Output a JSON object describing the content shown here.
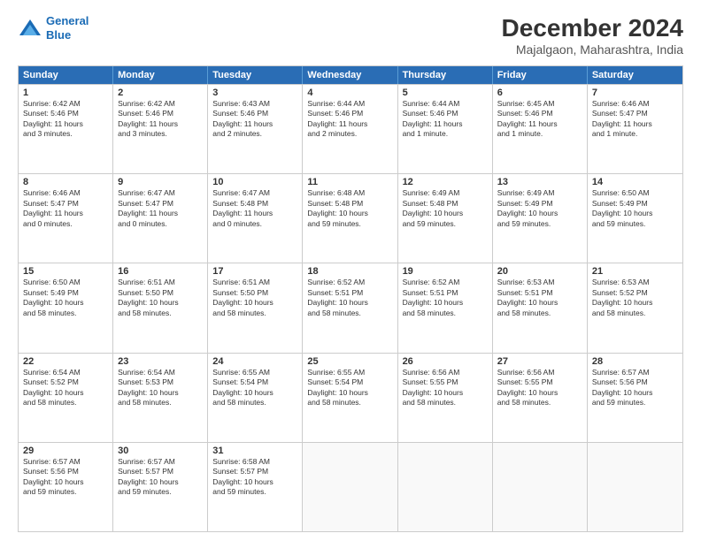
{
  "logo": {
    "line1": "General",
    "line2": "Blue"
  },
  "title": "December 2024",
  "subtitle": "Majalgaon, Maharashtra, India",
  "header_days": [
    "Sunday",
    "Monday",
    "Tuesday",
    "Wednesday",
    "Thursday",
    "Friday",
    "Saturday"
  ],
  "rows": [
    [
      {
        "day": "1",
        "text": "Sunrise: 6:42 AM\nSunset: 5:46 PM\nDaylight: 11 hours\nand 3 minutes."
      },
      {
        "day": "2",
        "text": "Sunrise: 6:42 AM\nSunset: 5:46 PM\nDaylight: 11 hours\nand 3 minutes."
      },
      {
        "day": "3",
        "text": "Sunrise: 6:43 AM\nSunset: 5:46 PM\nDaylight: 11 hours\nand 2 minutes."
      },
      {
        "day": "4",
        "text": "Sunrise: 6:44 AM\nSunset: 5:46 PM\nDaylight: 11 hours\nand 2 minutes."
      },
      {
        "day": "5",
        "text": "Sunrise: 6:44 AM\nSunset: 5:46 PM\nDaylight: 11 hours\nand 1 minute."
      },
      {
        "day": "6",
        "text": "Sunrise: 6:45 AM\nSunset: 5:46 PM\nDaylight: 11 hours\nand 1 minute."
      },
      {
        "day": "7",
        "text": "Sunrise: 6:46 AM\nSunset: 5:47 PM\nDaylight: 11 hours\nand 1 minute."
      }
    ],
    [
      {
        "day": "8",
        "text": "Sunrise: 6:46 AM\nSunset: 5:47 PM\nDaylight: 11 hours\nand 0 minutes."
      },
      {
        "day": "9",
        "text": "Sunrise: 6:47 AM\nSunset: 5:47 PM\nDaylight: 11 hours\nand 0 minutes."
      },
      {
        "day": "10",
        "text": "Sunrise: 6:47 AM\nSunset: 5:48 PM\nDaylight: 11 hours\nand 0 minutes."
      },
      {
        "day": "11",
        "text": "Sunrise: 6:48 AM\nSunset: 5:48 PM\nDaylight: 10 hours\nand 59 minutes."
      },
      {
        "day": "12",
        "text": "Sunrise: 6:49 AM\nSunset: 5:48 PM\nDaylight: 10 hours\nand 59 minutes."
      },
      {
        "day": "13",
        "text": "Sunrise: 6:49 AM\nSunset: 5:49 PM\nDaylight: 10 hours\nand 59 minutes."
      },
      {
        "day": "14",
        "text": "Sunrise: 6:50 AM\nSunset: 5:49 PM\nDaylight: 10 hours\nand 59 minutes."
      }
    ],
    [
      {
        "day": "15",
        "text": "Sunrise: 6:50 AM\nSunset: 5:49 PM\nDaylight: 10 hours\nand 58 minutes."
      },
      {
        "day": "16",
        "text": "Sunrise: 6:51 AM\nSunset: 5:50 PM\nDaylight: 10 hours\nand 58 minutes."
      },
      {
        "day": "17",
        "text": "Sunrise: 6:51 AM\nSunset: 5:50 PM\nDaylight: 10 hours\nand 58 minutes."
      },
      {
        "day": "18",
        "text": "Sunrise: 6:52 AM\nSunset: 5:51 PM\nDaylight: 10 hours\nand 58 minutes."
      },
      {
        "day": "19",
        "text": "Sunrise: 6:52 AM\nSunset: 5:51 PM\nDaylight: 10 hours\nand 58 minutes."
      },
      {
        "day": "20",
        "text": "Sunrise: 6:53 AM\nSunset: 5:51 PM\nDaylight: 10 hours\nand 58 minutes."
      },
      {
        "day": "21",
        "text": "Sunrise: 6:53 AM\nSunset: 5:52 PM\nDaylight: 10 hours\nand 58 minutes."
      }
    ],
    [
      {
        "day": "22",
        "text": "Sunrise: 6:54 AM\nSunset: 5:52 PM\nDaylight: 10 hours\nand 58 minutes."
      },
      {
        "day": "23",
        "text": "Sunrise: 6:54 AM\nSunset: 5:53 PM\nDaylight: 10 hours\nand 58 minutes."
      },
      {
        "day": "24",
        "text": "Sunrise: 6:55 AM\nSunset: 5:54 PM\nDaylight: 10 hours\nand 58 minutes."
      },
      {
        "day": "25",
        "text": "Sunrise: 6:55 AM\nSunset: 5:54 PM\nDaylight: 10 hours\nand 58 minutes."
      },
      {
        "day": "26",
        "text": "Sunrise: 6:56 AM\nSunset: 5:55 PM\nDaylight: 10 hours\nand 58 minutes."
      },
      {
        "day": "27",
        "text": "Sunrise: 6:56 AM\nSunset: 5:55 PM\nDaylight: 10 hours\nand 58 minutes."
      },
      {
        "day": "28",
        "text": "Sunrise: 6:57 AM\nSunset: 5:56 PM\nDaylight: 10 hours\nand 59 minutes."
      }
    ],
    [
      {
        "day": "29",
        "text": "Sunrise: 6:57 AM\nSunset: 5:56 PM\nDaylight: 10 hours\nand 59 minutes."
      },
      {
        "day": "30",
        "text": "Sunrise: 6:57 AM\nSunset: 5:57 PM\nDaylight: 10 hours\nand 59 minutes."
      },
      {
        "day": "31",
        "text": "Sunrise: 6:58 AM\nSunset: 5:57 PM\nDaylight: 10 hours\nand 59 minutes."
      },
      {
        "day": "",
        "text": ""
      },
      {
        "day": "",
        "text": ""
      },
      {
        "day": "",
        "text": ""
      },
      {
        "day": "",
        "text": ""
      }
    ]
  ]
}
